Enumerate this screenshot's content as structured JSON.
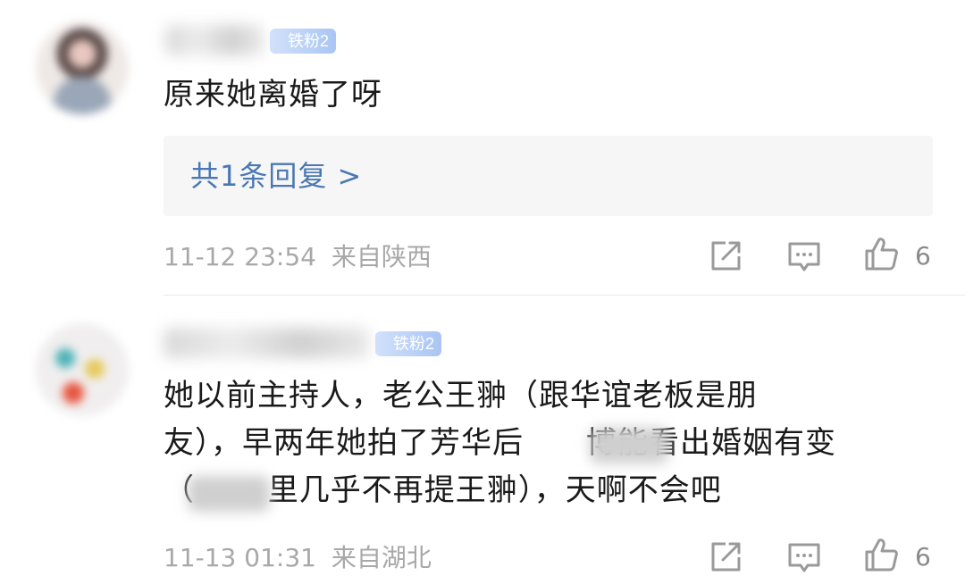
{
  "comments": [
    {
      "fan_badge": "铁粉2",
      "text_lines": [
        "原来她离婚了呀"
      ],
      "reply_link": "共1条回复 >",
      "time": "11-12 23:54",
      "location": "来自陕西",
      "likes": "6"
    },
    {
      "fan_badge": "铁粉2",
      "text_lines": [
        "她以前主持人，老公王翀（跟华谊老板是朋",
        "友），早两年她拍了芳华后　　博能看出婚姻有变",
        "（　　 里几乎不再提王翀），天啊不会吧"
      ],
      "time": "11-13 01:31",
      "location": "来自湖北",
      "likes": "6"
    }
  ],
  "icons": {
    "share": "share-square-icon",
    "comment": "comment-bubble-icon",
    "like": "thumbs-up-icon"
  },
  "colors": {
    "link": "#4a78b3",
    "meta": "#a8a8a8",
    "reply_bg": "#f6f6f6",
    "badge": "#a9c5f4"
  }
}
